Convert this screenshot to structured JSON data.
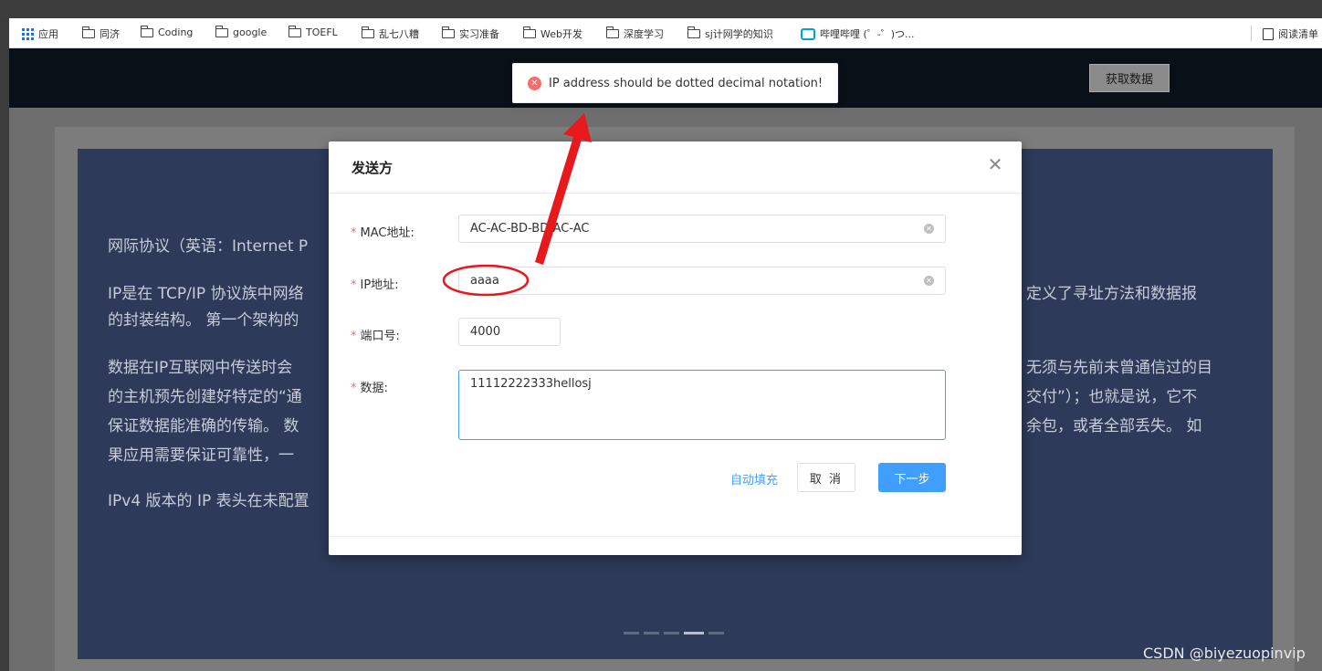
{
  "bookmarks": {
    "apps_label": "应用",
    "folders": [
      "同济",
      "Coding",
      "google",
      "TOEFL",
      "乱七八糟",
      "实习准备",
      "Web开发",
      "深度学习",
      "sj计网学的知识"
    ],
    "bilibili_label": "哔哩哔哩 (゜-゜)つ...",
    "reading_list_label": "阅读清单"
  },
  "navbar": {
    "fetch_button": "获取数据"
  },
  "toast": {
    "message": "IP address should be dotted decimal notation!",
    "type": "error"
  },
  "background_text": {
    "line1": "网际协议（英语：Internet P",
    "line2a": "IP是在 TCP/IP 协议族中网络",
    "line2b": "定义了寻址方法和数据报",
    "line3": "的封装结构。 第一个架构的",
    "line4a": "数据在IP互联网中传送时会",
    "line4b": "无须与先前未曾通信过的目",
    "line5a": "的主机预先创建好特定的“通",
    "line5b": "交付”）；也就是说，它不",
    "line6a": "保证数据能准确的传输。 数",
    "line6b": "余包，或者全部丢失。 如",
    "line7": "果应用需要保证可靠性，一",
    "line8": "IPv4 版本的 IP 表头在未配置"
  },
  "modal": {
    "title": "发送方",
    "mac_label": "MAC地址:",
    "mac_value": "AC-AC-BD-BD-AC-AC",
    "ip_label": "IP地址:",
    "ip_value": "aaaa",
    "port_label": "端口号:",
    "port_value": "4000",
    "data_label": "数据:",
    "data_value": "11112222333hellosj",
    "autofill_label": "自动填充",
    "cancel_label": "取 消",
    "next_label": "下一步",
    "required_mark": "*"
  },
  "watermark": "CSDN @biyezuopinvip",
  "colors": {
    "primary": "#409eff",
    "error": "#f56c6c",
    "annotation": "#e8191d",
    "carousel_bg": "#2d3a5a"
  }
}
